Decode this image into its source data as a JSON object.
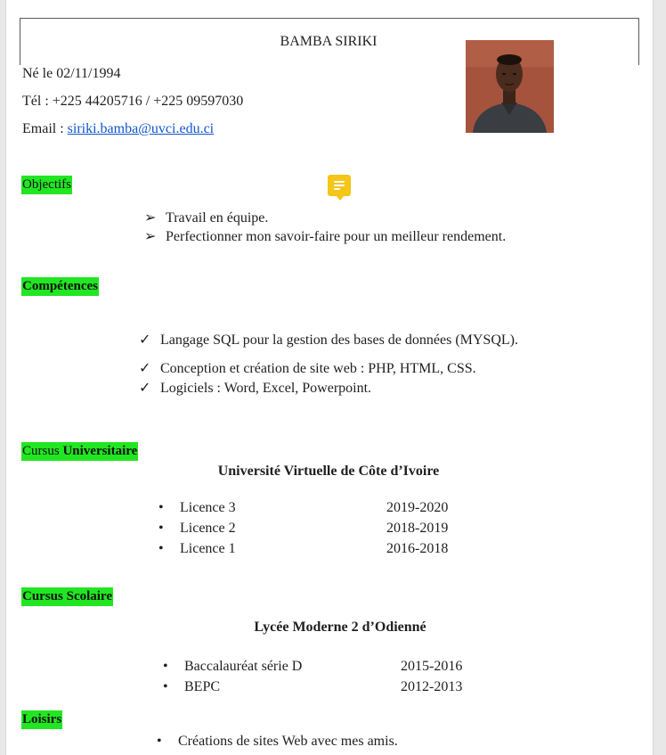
{
  "header": {
    "name": "BAMBA SIRIKI",
    "birth": "Né le 02/11/1994",
    "phone": "Tél : +225 44205716 / +225 09597030",
    "email_label": "Email : ",
    "email": "siriki.bamba@uvci.edu.ci"
  },
  "objectifs": {
    "title": "Objectifs",
    "marker": "➢",
    "items": [
      "Travail en équipe.",
      "Perfectionner mon savoir-faire pour un meilleur rendement."
    ]
  },
  "competences": {
    "title": "Compétences",
    "marker": "✓",
    "items": [
      "Langage SQL pour la gestion des bases de données (MYSQL).",
      "Conception et création de site web : PHP, HTML, CSS.",
      "Logiciels : Word, Excel, Powerpoint."
    ]
  },
  "cursus_universitaire": {
    "title_part1": "Cursus ",
    "title_part2": "Universitaire",
    "school": "Université Virtuelle de Côte d’Ivoire",
    "bullet": "•",
    "items": [
      {
        "label": "Licence 3",
        "years": "2019-2020"
      },
      {
        "label": "Licence 2",
        "years": "2018-2019"
      },
      {
        "label": "Licence 1",
        "years": "2016-2018"
      }
    ]
  },
  "cursus_scolaire": {
    "title": "Cursus Scolaire",
    "school": "Lycée Moderne 2 d’Odienné",
    "bullet": "•",
    "items": [
      {
        "label": "Baccalauréat série D",
        "years": "2015-2016"
      },
      {
        "label": "BEPC",
        "years": "2012-2013"
      }
    ]
  },
  "loisirs": {
    "title": "Loisirs",
    "bullet": "•",
    "items": [
      "Créations de sites Web avec mes amis."
    ]
  },
  "icons": {
    "comment": "comment-icon",
    "comment_color": "#f5c518",
    "highlight_color": "#22e622"
  }
}
